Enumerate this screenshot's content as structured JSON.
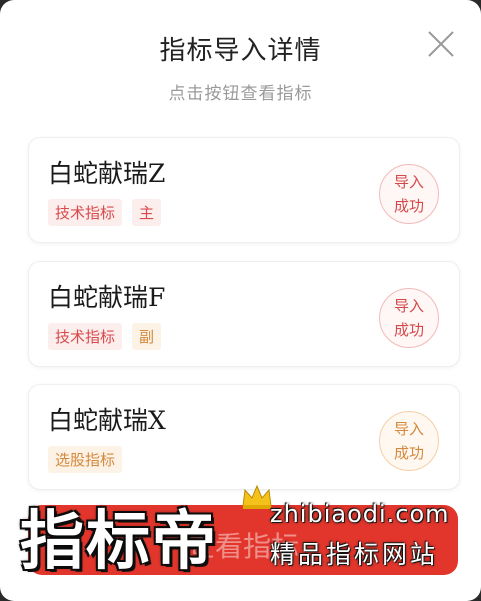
{
  "dialog": {
    "title": "指标导入详情",
    "subtitle": "点击按钮查看指标"
  },
  "cards": [
    {
      "name": "白蛇献瑞Z",
      "tags": [
        "技术指标",
        "主"
      ],
      "status_line1": "导入",
      "status_line2": "成功"
    },
    {
      "name": "白蛇献瑞F",
      "tags": [
        "技术指标",
        "副"
      ],
      "status_line1": "导入",
      "status_line2": "成功"
    },
    {
      "name": "白蛇献瑞X",
      "tags": [
        "选股指标"
      ],
      "status_line1": "导入",
      "status_line2": "成功"
    }
  ],
  "bottom_button": {
    "label": "查看指标"
  },
  "watermark": {
    "brand": "指标帝",
    "url": "zhibiaodi.com",
    "slogan": "精品指标网站"
  },
  "colors": {
    "accent_red": "#e2362c",
    "tag_red": "#d94a4a",
    "tag_orange": "#d4893c"
  }
}
